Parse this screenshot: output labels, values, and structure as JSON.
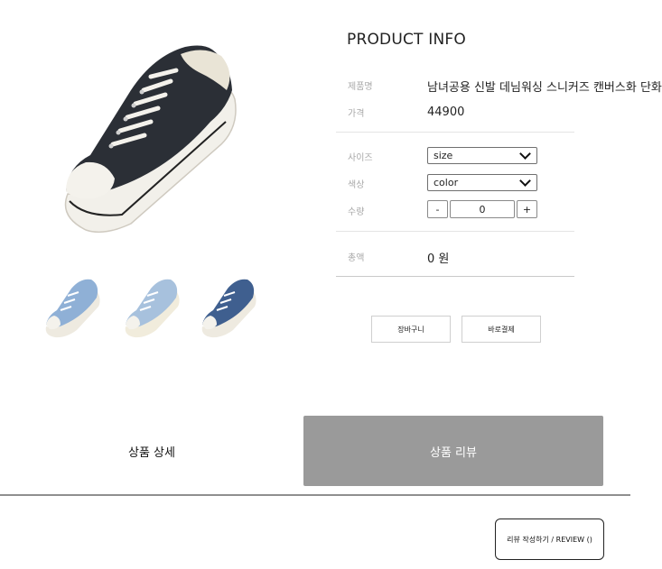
{
  "product_info": {
    "title": "PRODUCT INFO",
    "name_label": "제품명",
    "name_value": "남녀공용 신발 데님워싱 스니커즈 캔버스화 단화",
    "price_label": "가격",
    "price_value": "44900",
    "size_label": "사이즈",
    "size_selected": "size",
    "color_label": "색상",
    "color_selected": "color",
    "quantity_label": "수량",
    "quantity_minus": "-",
    "quantity_value": "0",
    "quantity_plus": "+",
    "total_label": "총액",
    "total_value": "0 원"
  },
  "actions": {
    "cart_label": "장바구니",
    "buy_label": "바로결제"
  },
  "tabs": {
    "detail_label": "상품 상세",
    "review_label": "상품 리뷰"
  },
  "review": {
    "write_label": "리뷰 작성하기 / REVIEW ()"
  },
  "colors": {
    "main_shoe": "#2b2f36",
    "thumb_1": "#8fb0d6",
    "thumb_2": "#a7c1dd",
    "thumb_3": "#3f5f8f",
    "review_tab_bg": "#9a9a9a"
  },
  "icons": [
    "chevron-down-icon"
  ]
}
